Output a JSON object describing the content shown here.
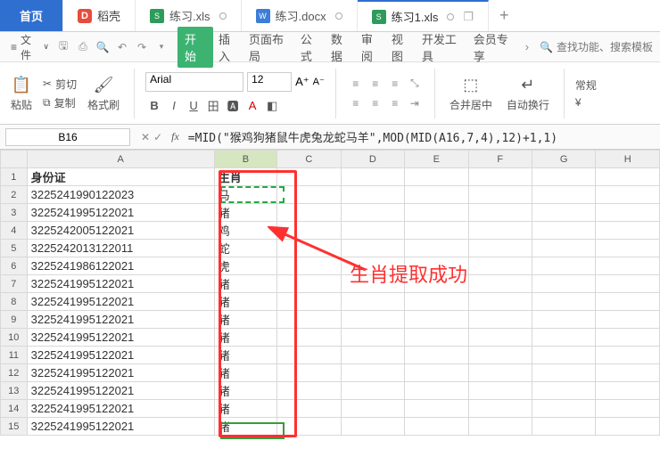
{
  "tabs": {
    "home": "首页",
    "daoke": "稻壳",
    "file1": "练习.xls",
    "file2": "练习.docx",
    "file3": "练习1.xls"
  },
  "menu": {
    "file": "文件",
    "ribbon": {
      "start": "开始",
      "insert": "插入",
      "layout": "页面布局",
      "formula": "公式",
      "data": "数据",
      "review": "审阅",
      "view": "视图",
      "dev": "开发工具",
      "member": "会员专享"
    },
    "search_placeholder": "查找功能、搜索模板"
  },
  "ribbon": {
    "cut": "剪切",
    "copy": "复制",
    "paste": "粘贴",
    "format_painter": "格式刷",
    "font_name": "Arial",
    "font_size": "12",
    "merge": "合并居中",
    "wrap": "自动换行",
    "general": "常规"
  },
  "fx": {
    "name_box": "B16",
    "formula": "=MID(\"猴鸡狗猪鼠牛虎兔龙蛇马羊\",MOD(MID(A16,7,4),12)+1,1)"
  },
  "columns": [
    "A",
    "B",
    "C",
    "D",
    "E",
    "F",
    "G",
    "H"
  ],
  "header": {
    "A": "身份证",
    "B": "生肖"
  },
  "rows": [
    {
      "n": 1,
      "a": "身份证",
      "b": "生肖"
    },
    {
      "n": 2,
      "a": "3225241990122023",
      "b": "马"
    },
    {
      "n": 3,
      "a": "3225241995122021",
      "b": "猪"
    },
    {
      "n": 4,
      "a": "3225242005122021",
      "b": "鸡"
    },
    {
      "n": 5,
      "a": "3225242013122011",
      "b": "蛇"
    },
    {
      "n": 6,
      "a": "3225241986122021",
      "b": "虎"
    },
    {
      "n": 7,
      "a": "3225241995122021",
      "b": "猪"
    },
    {
      "n": 8,
      "a": "3225241995122021",
      "b": "猪"
    },
    {
      "n": 9,
      "a": "3225241995122021",
      "b": "猪"
    },
    {
      "n": 10,
      "a": "3225241995122021",
      "b": "猪"
    },
    {
      "n": 11,
      "a": "3225241995122021",
      "b": "猪"
    },
    {
      "n": 12,
      "a": "3225241995122021",
      "b": "猪"
    },
    {
      "n": 13,
      "a": "3225241995122021",
      "b": "猪"
    },
    {
      "n": 14,
      "a": "3225241995122021",
      "b": "猪"
    },
    {
      "n": 15,
      "a": "3225241995122021",
      "b": "猪"
    }
  ],
  "annotation": "生肖提取成功"
}
